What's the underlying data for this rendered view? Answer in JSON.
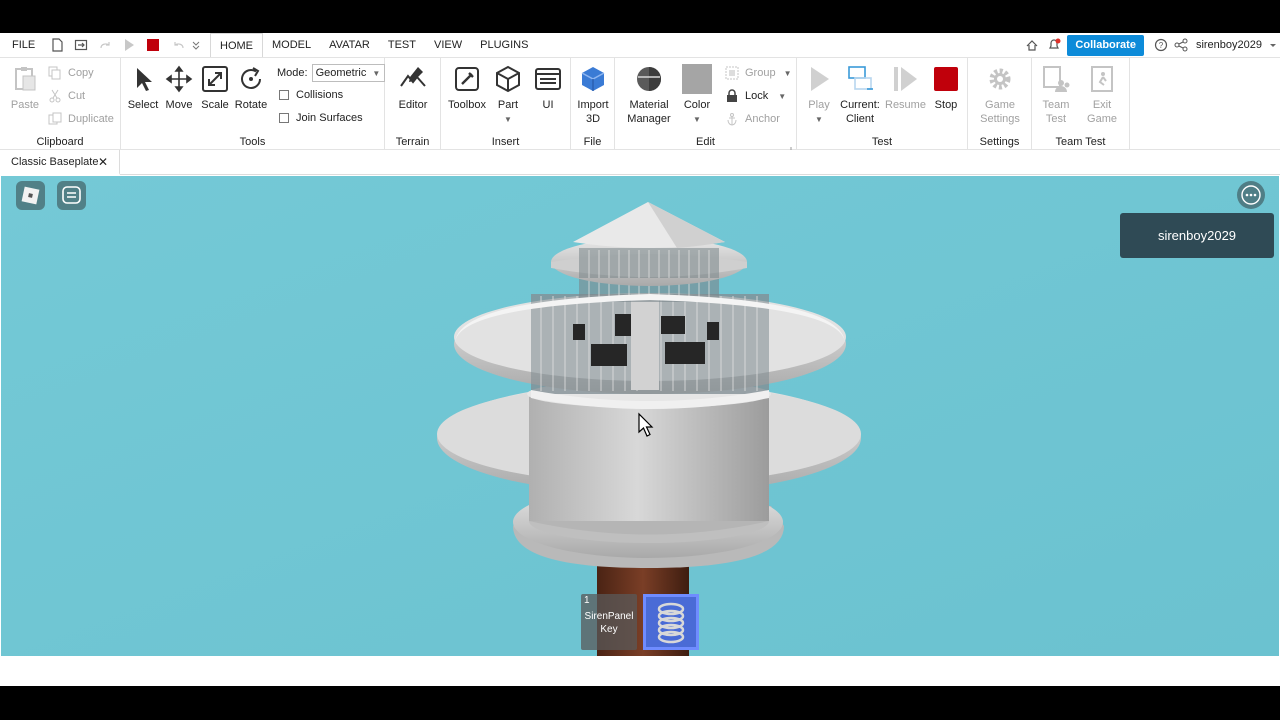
{
  "menu": {
    "file": "FILE",
    "tabs": [
      "HOME",
      "MODEL",
      "AVATAR",
      "TEST",
      "VIEW",
      "PLUGINS"
    ],
    "collaborate": "Collaborate",
    "username": "sirenboy2029"
  },
  "ribbon": {
    "clipboard": {
      "paste": "Paste",
      "copy": "Copy",
      "cut": "Cut",
      "duplicate": "Duplicate",
      "label": "Clipboard"
    },
    "tools": {
      "select": "Select",
      "move": "Move",
      "scale": "Scale",
      "rotate": "Rotate",
      "mode_label": "Mode:",
      "mode_value": "Geometric",
      "collisions": "Collisions",
      "join_surfaces": "Join Surfaces",
      "label": "Tools"
    },
    "terrain": {
      "editor": "Editor",
      "label": "Terrain"
    },
    "insert": {
      "toolbox": "Toolbox",
      "part": "Part",
      "ui": "UI",
      "label": "Insert"
    },
    "file": {
      "import3d_1": "Import",
      "import3d_2": "3D",
      "label": "File"
    },
    "edit": {
      "material_1": "Material",
      "material_2": "Manager",
      "color": "Color",
      "group": "Group",
      "lock": "Lock",
      "anchor": "Anchor",
      "label": "Edit"
    },
    "test": {
      "play": "Play",
      "current_1": "Current:",
      "current_2": "Client",
      "resume": "Resume",
      "stop": "Stop",
      "label": "Test"
    },
    "settings": {
      "game_1": "Game",
      "game_2": "Settings",
      "label": "Settings"
    },
    "team_test": {
      "team_1": "Team",
      "team_2": "Test",
      "exit_1": "Exit",
      "exit_2": "Game",
      "label": "Team Test"
    }
  },
  "document_tab": {
    "title": "Classic Baseplate",
    "close": "✕"
  },
  "viewport": {
    "player_name": "sirenboy2029",
    "hotbar": [
      {
        "slot": "1",
        "label_1": "SirenPanel",
        "label_2": "Key"
      }
    ],
    "sky_color": "#6ec5d3"
  },
  "colors": {
    "accent": "#0d8bd9",
    "stop": "#c0000b",
    "trunk": "#6b3522"
  }
}
